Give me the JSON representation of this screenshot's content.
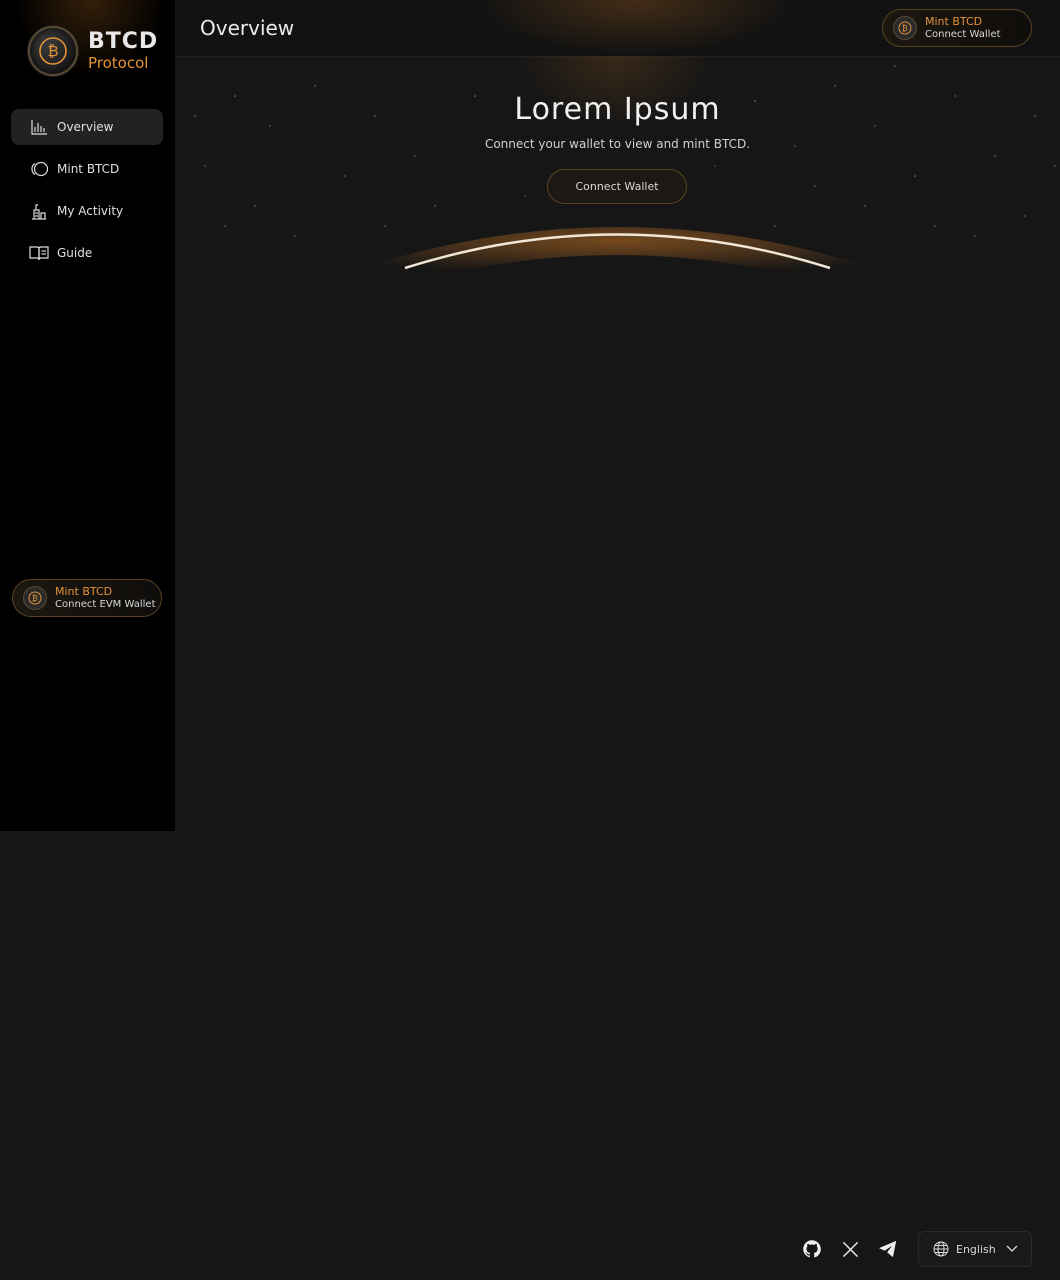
{
  "brand": {
    "title": "BTCD",
    "subtitle": "Protocol"
  },
  "sidebar": {
    "items": [
      {
        "label": "Overview",
        "icon": "bar-chart-icon",
        "active": true
      },
      {
        "label": "Mint BTCD",
        "icon": "coins-icon",
        "active": false
      },
      {
        "label": "My Activity",
        "icon": "activity-icon",
        "active": false
      },
      {
        "label": "Guide",
        "icon": "book-icon",
        "active": false
      }
    ],
    "mint": {
      "title": "Mint BTCD",
      "subtitle": "Connect EVM Wallet"
    }
  },
  "header": {
    "title": "Overview",
    "mint": {
      "title": "Mint BTCD",
      "subtitle": "Connect Wallet"
    }
  },
  "hero": {
    "title": "Lorem Ipsum",
    "subtitle": "Connect your wallet to view and mint BTCD.",
    "button": "Connect Wallet"
  },
  "footer": {
    "social": [
      "github-icon",
      "x-icon",
      "telegram-icon"
    ],
    "language": "English"
  },
  "colors": {
    "accent": "#e3923a",
    "background": "#161616",
    "sidebar": "#000000"
  }
}
